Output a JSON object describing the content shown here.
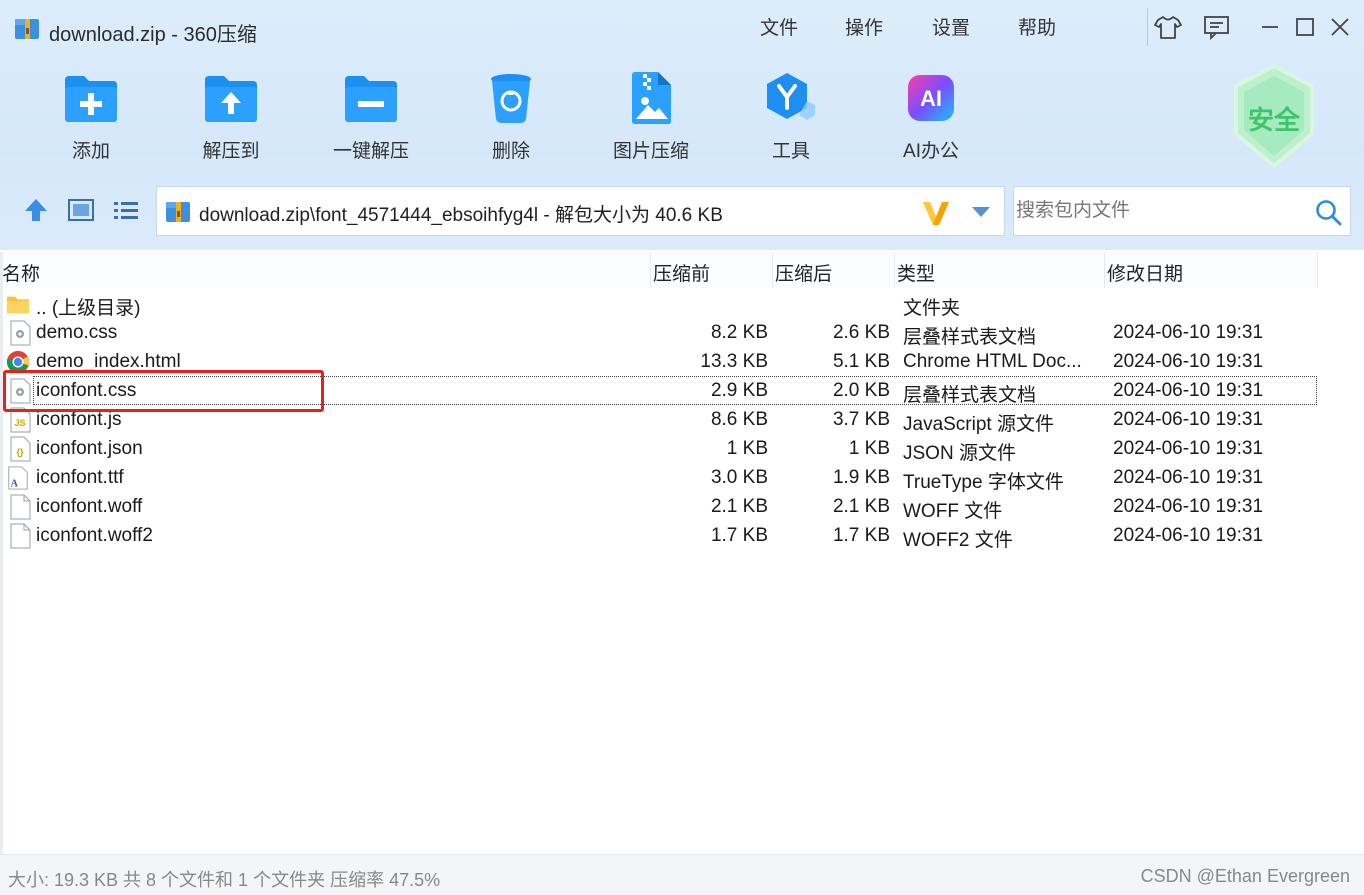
{
  "window": {
    "title": "download.zip - 360压缩",
    "menu": [
      "文件",
      "操作",
      "设置",
      "帮助"
    ]
  },
  "toolbar": {
    "items": [
      {
        "label": "添加",
        "icon": "add-folder-icon"
      },
      {
        "label": "解压到",
        "icon": "extract-folder-icon"
      },
      {
        "label": "一键解压",
        "icon": "one-click-extract-icon"
      },
      {
        "label": "删除",
        "icon": "trash-icon"
      },
      {
        "label": "图片压缩",
        "icon": "image-compress-icon"
      },
      {
        "label": "工具",
        "icon": "tools-icon"
      },
      {
        "label": "AI办公",
        "icon": "ai-office-icon"
      }
    ],
    "safe_badge": "安全"
  },
  "address": {
    "path": "download.zip\\font_4571444_ebsoihfyg4l - 解包大小为 40.6 KB"
  },
  "search": {
    "placeholder": "搜索包内文件"
  },
  "columns": [
    "名称",
    "压缩前",
    "压缩后",
    "类型",
    "修改日期"
  ],
  "files": [
    {
      "name": ".. (上级目录)",
      "size": "",
      "packed": "",
      "type": "文件夹",
      "date": "",
      "icon": "folder-icon"
    },
    {
      "name": "demo.css",
      "size": "8.2 KB",
      "packed": "2.6 KB",
      "type": "层叠样式表文档",
      "date": "2024-06-10 19:31",
      "icon": "css-file-icon"
    },
    {
      "name": "demo_index.html",
      "size": "13.3 KB",
      "packed": "5.1 KB",
      "type": "Chrome HTML Doc...",
      "date": "2024-06-10 19:31",
      "icon": "chrome-icon"
    },
    {
      "name": "iconfont.css",
      "size": "2.9 KB",
      "packed": "2.0 KB",
      "type": "层叠样式表文档",
      "date": "2024-06-10 19:31",
      "icon": "css-file-icon"
    },
    {
      "name": "iconfont.js",
      "size": "8.6 KB",
      "packed": "3.7 KB",
      "type": "JavaScript 源文件",
      "date": "2024-06-10 19:31",
      "icon": "js-file-icon"
    },
    {
      "name": "iconfont.json",
      "size": "1 KB",
      "packed": "1 KB",
      "type": "JSON 源文件",
      "date": "2024-06-10 19:31",
      "icon": "json-file-icon"
    },
    {
      "name": "iconfont.ttf",
      "size": "3.0 KB",
      "packed": "1.9 KB",
      "type": "TrueType 字体文件",
      "date": "2024-06-10 19:31",
      "icon": "font-file-icon"
    },
    {
      "name": "iconfont.woff",
      "size": "2.1 KB",
      "packed": "2.1 KB",
      "type": "WOFF 文件",
      "date": "2024-06-10 19:31",
      "icon": "blank-file-icon"
    },
    {
      "name": "iconfont.woff2",
      "size": "1.7 KB",
      "packed": "1.7 KB",
      "type": "WOFF2 文件",
      "date": "2024-06-10 19:31",
      "icon": "blank-file-icon"
    }
  ],
  "status": {
    "summary": "大小: 19.3 KB 共 8 个文件和 1 个文件夹 压缩率 47.5%",
    "watermark": "CSDN @Ethan Evergreen"
  },
  "colors": {
    "accent": "#2a8de3",
    "highlight": "#e8211f",
    "safe_green": "#3fc46b"
  }
}
